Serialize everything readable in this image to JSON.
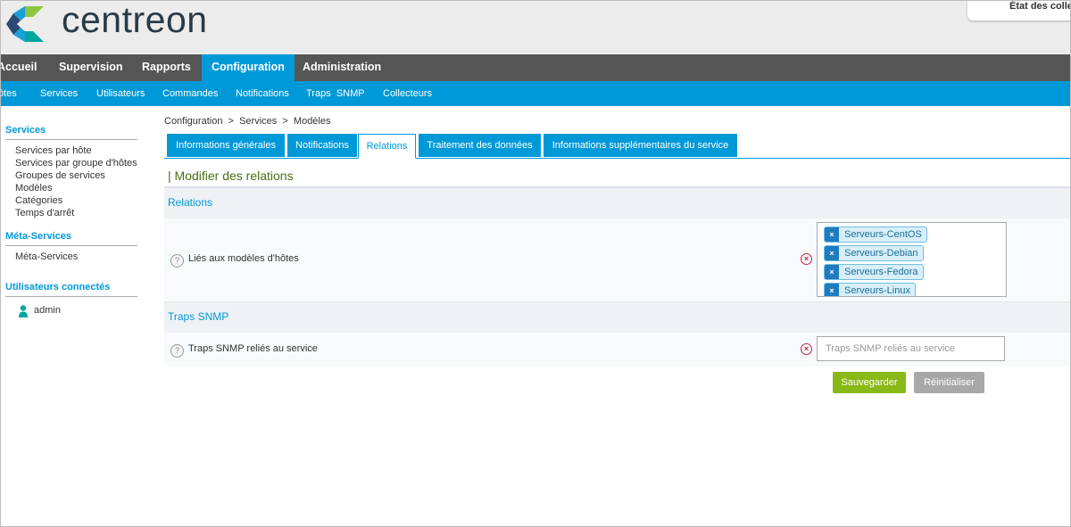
{
  "brand": {
    "logo_text": "centreon",
    "colors": {
      "primary_blue": "#0099d8",
      "green": "#88b917",
      "dark_bar": "#555555"
    }
  },
  "header": {
    "poller_status_label": "État des colle"
  },
  "main_menu": {
    "items": [
      {
        "label": "Accueil"
      },
      {
        "label": "Supervision"
      },
      {
        "label": "Rapports"
      },
      {
        "label": "Configuration"
      },
      {
        "label": "Administration"
      }
    ],
    "active": "Configuration"
  },
  "sub_menu": {
    "items": [
      {
        "label": "Hôtes"
      },
      {
        "label": "Services"
      },
      {
        "label": "Utilisateurs"
      },
      {
        "label": "Commandes"
      },
      {
        "label": "Notifications"
      },
      {
        "label": "Traps  SNMP"
      },
      {
        "label": "Collecteurs"
      }
    ]
  },
  "sidebar": {
    "sections": [
      {
        "title": "Services",
        "items": [
          "Services par hôte",
          "Services par groupe d'hôtes",
          "Groupes de services",
          "Modèles",
          "Catégories",
          "Temps d'arrêt"
        ]
      },
      {
        "title": "Méta-Services",
        "items": [
          "Méta-Services"
        ]
      },
      {
        "title": "Utilisateurs connectés",
        "items": [
          "admin"
        ]
      }
    ]
  },
  "breadcrumb": "Configuration  >  Services  >  Modèles",
  "tabs": [
    {
      "label": "Informations générales"
    },
    {
      "label": "Notifications"
    },
    {
      "label": "Relations"
    },
    {
      "label": "Traitement des données"
    },
    {
      "label": "Informations supplémentaires du service"
    }
  ],
  "active_tab": "Relations",
  "form": {
    "title": "| Modifier des relations",
    "sections": {
      "relations": {
        "title": "Relations",
        "field_label": "Liés aux modèles d'hôtes",
        "help_glyph": "?",
        "clear_glyph": "×",
        "selected": [
          "Serveurs-CentOS",
          "Serveurs-Debian",
          "Serveurs-Fedora",
          "Serveurs-Linux"
        ],
        "chip_remove_glyph": "×"
      },
      "traps": {
        "title": "Traps SNMP",
        "field_label": "Traps SNMP reliés au service",
        "help_glyph": "?",
        "clear_glyph": "×",
        "placeholder": "Traps SNMP reliés au service"
      }
    },
    "buttons": {
      "save": "Sauvegarder",
      "reset": "Réinitialiser"
    }
  }
}
